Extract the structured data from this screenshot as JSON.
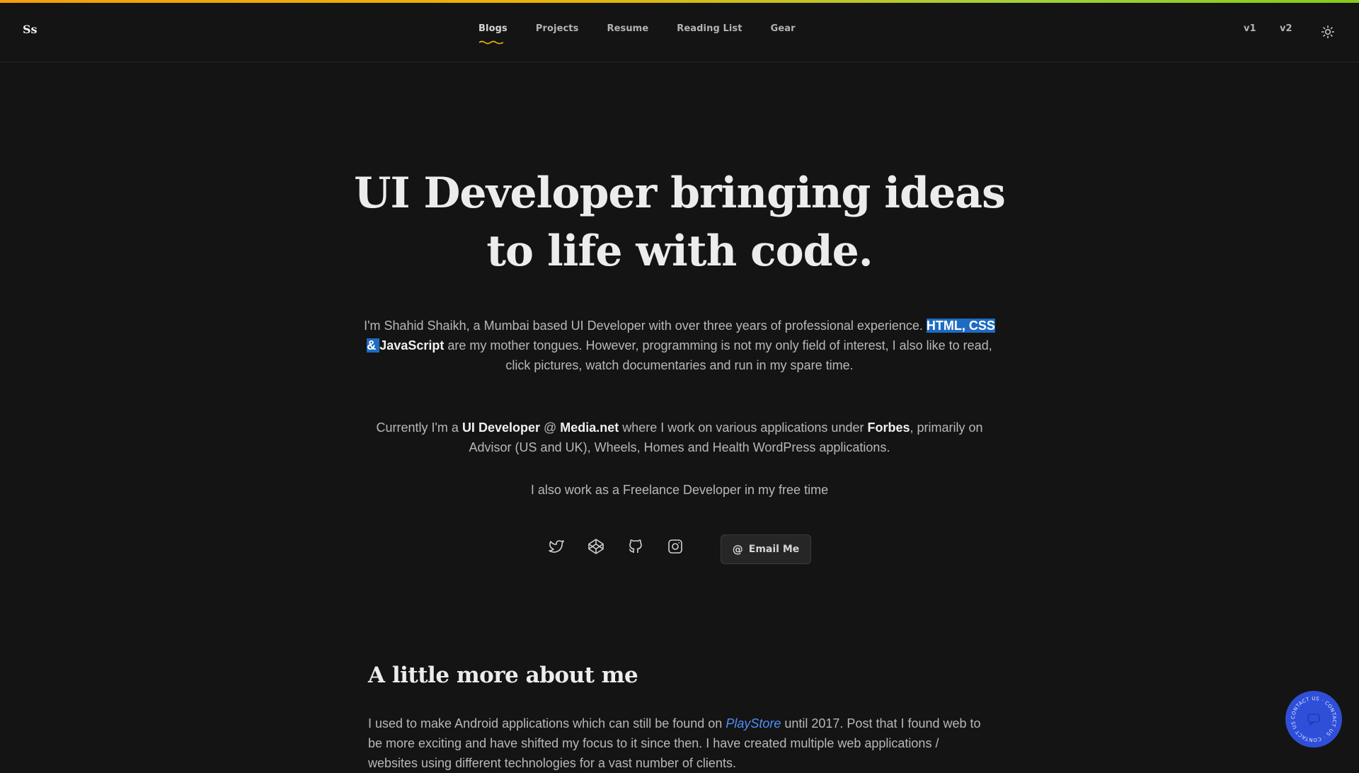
{
  "header": {
    "logo": "Ss",
    "nav": [
      "Blogs",
      "Projects",
      "Resume",
      "Reading List",
      "Gear"
    ],
    "active_nav": "Blogs",
    "versions": [
      "v1",
      "v2"
    ],
    "theme_icon": "sun-icon"
  },
  "hero": {
    "title": "UI Developer bringing ideas to life with code.",
    "p1": {
      "a": "I'm Shahid Shaikh, a Mumbai based UI Developer with over three years of professional experience. ",
      "highlight": "HTML, CSS & ",
      "strong": "JavaScript",
      "b": " are my mother tongues. However, programming is not my only field of interest, I also like to read, click pictures, watch documentaries and run in my spare time."
    },
    "p2": {
      "a": "Currently I'm a ",
      "role": "UI Developer",
      "at": " @ ",
      "company": "Media.net",
      "b": " where I work on various applications under ",
      "client": "Forbes",
      "c": ", primarily on Advisor (US and UK), Wheels, Homes and Health WordPress applications."
    },
    "p3": "I also work as a Freelance Developer in my free time"
  },
  "socials": {
    "icons": [
      "twitter-icon",
      "codepen-icon",
      "github-icon",
      "instagram-icon"
    ],
    "email_symbol": "@",
    "email_label": "Email Me"
  },
  "about": {
    "title": "A little more about me",
    "text_a": "I used to make Android applications which can still be found on ",
    "link": "PlayStore",
    "text_b": " until 2017. Post that I found web to be more exciting and have shifted my focus to it since then. I have created multiple web applications / websites using different technologies for a vast number of clients."
  },
  "contact_badge": {
    "text": "CONTACT US · CONTACT US · CONTACT US ·"
  },
  "colors": {
    "background": "#141414",
    "accent_gradient_start": "#f59e0b",
    "accent_gradient_end": "#84cc16",
    "highlight": "#1f6bc2",
    "link": "#4f8ff7",
    "contact_badge": "#2f4fd8"
  }
}
